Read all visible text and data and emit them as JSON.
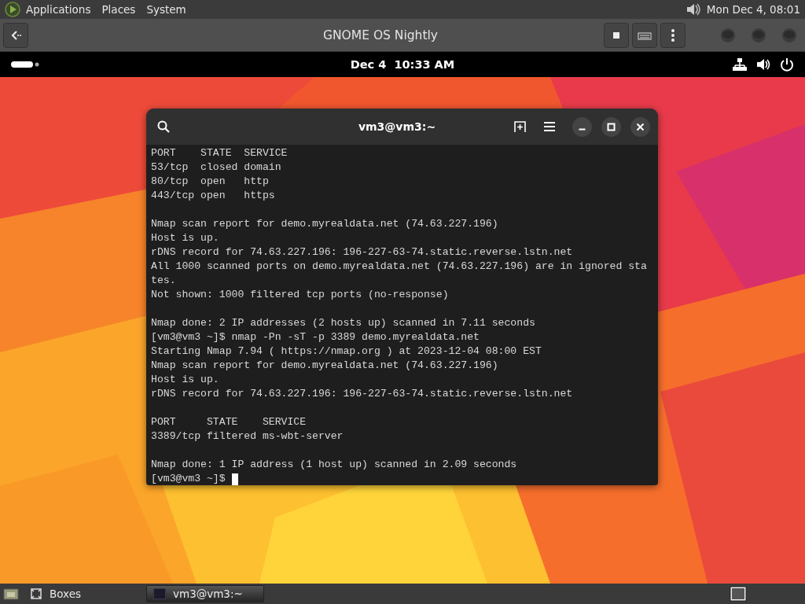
{
  "top_panel": {
    "menus": [
      "Applications",
      "Places",
      "System"
    ],
    "clock": "Mon Dec 4, 08:01"
  },
  "boxes_header": {
    "title": "GNOME OS Nightly"
  },
  "gnome_top_bar": {
    "clock": "Dec 4  10:33 AM"
  },
  "terminal": {
    "title": "vm3@vm3:~",
    "output_blocks": [
      [
        "PORT    STATE  SERVICE",
        "53/tcp  closed domain",
        "80/tcp  open   http",
        "443/tcp open   https"
      ],
      [
        "Nmap scan report for demo.myrealdata.net (74.63.227.196)",
        "Host is up.",
        "rDNS record for 74.63.227.196: 196-227-63-74.static.reverse.lstn.net",
        "All 1000 scanned ports on demo.myrealdata.net (74.63.227.196) are in ignored sta",
        "tes.",
        "Not shown: 1000 filtered tcp ports (no-response)"
      ],
      [
        "Nmap done: 2 IP addresses (2 hosts up) scanned in 7.11 seconds",
        "[vm3@vm3 ~]$ nmap -Pn -sT -p 3389 demo.myrealdata.net",
        "Starting Nmap 7.94 ( https://nmap.org ) at 2023-12-04 08:00 EST",
        "Nmap scan report for demo.myrealdata.net (74.63.227.196)",
        "Host is up.",
        "rDNS record for 74.63.227.196: 196-227-63-74.static.reverse.lstn.net"
      ],
      [
        "PORT     STATE    SERVICE",
        "3389/tcp filtered ms-wbt-server"
      ],
      [
        "Nmap done: 1 IP address (1 host up) scanned in 2.09 seconds",
        "[vm3@vm3 ~]$"
      ]
    ]
  },
  "taskbar": {
    "items": [
      {
        "label": "Boxes",
        "selected": false
      },
      {
        "label": "vm3@vm3:~",
        "selected": true
      }
    ]
  }
}
